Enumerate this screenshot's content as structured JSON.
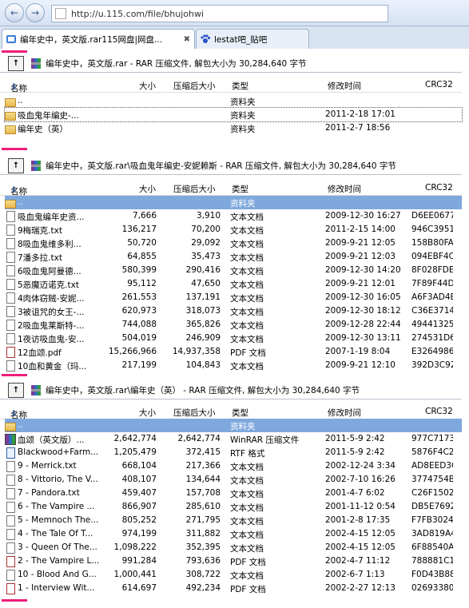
{
  "browser": {
    "url": "http://u.115.com/file/bhujohwi",
    "tabs": [
      {
        "label": "编年史中，英文版.rar115网盘|网盘..."
      },
      {
        "label": "lestat吧_贴吧"
      }
    ]
  },
  "columns": {
    "name": "名称",
    "size": "大小",
    "compressed": "压缩后大小",
    "type": "类型",
    "modified": "修改时间",
    "crc": "CRC32"
  },
  "panels": [
    {
      "path": "编年史中，英文版.rar - RAR 压缩文件, 解包大小为 30,284,640 字节",
      "rows": [
        {
          "icon": "folder",
          "name": "..",
          "size": "",
          "csize": "",
          "type": "资料夹",
          "time": "",
          "crc": ""
        },
        {
          "icon": "folder",
          "name": "吸血鬼年编史-...",
          "size": "",
          "csize": "",
          "type": "资料夹",
          "time": "2011-2-18 17:01",
          "crc": ""
        },
        {
          "icon": "folder",
          "name": "编年史（英）",
          "size": "",
          "csize": "",
          "type": "资料夹",
          "time": "2011-2-7 18:56",
          "crc": ""
        }
      ]
    },
    {
      "path": "编年史中，英文版.rar\\吸血鬼年编史-安妮赖斯 - RAR 压缩文件, 解包大小为 30,284,640 字节",
      "rows": [
        {
          "icon": "folder",
          "name": "..",
          "size": "",
          "csize": "",
          "type": "资料夹",
          "time": "",
          "crc": ""
        },
        {
          "icon": "txt",
          "name": "吸血鬼编年史资...",
          "size": "7,666",
          "csize": "3,910",
          "type": "文本文档",
          "time": "2009-12-30 16:27",
          "crc": "D6EE0677"
        },
        {
          "icon": "txt",
          "name": "9梅瑞克.txt",
          "size": "136,217",
          "csize": "70,200",
          "type": "文本文档",
          "time": "2011-2-15 14:00",
          "crc": "946C3951"
        },
        {
          "icon": "txt",
          "name": "8吸血鬼维多利...",
          "size": "50,720",
          "csize": "29,092",
          "type": "文本文档",
          "time": "2009-9-21 12:05",
          "crc": "158B80FA"
        },
        {
          "icon": "txt",
          "name": "7潘多拉.txt",
          "size": "64,855",
          "csize": "35,473",
          "type": "文本文档",
          "time": "2009-9-21 12:03",
          "crc": "094EBF4C"
        },
        {
          "icon": "txt",
          "name": "6吸血鬼阿曼德...",
          "size": "580,399",
          "csize": "290,416",
          "type": "文本文档",
          "time": "2009-12-30 14:20",
          "crc": "8F028FDE"
        },
        {
          "icon": "txt",
          "name": "5恶魔迈诺克.txt",
          "size": "95,112",
          "csize": "47,650",
          "type": "文本文档",
          "time": "2009-9-21 12:01",
          "crc": "7F89F44D"
        },
        {
          "icon": "txt",
          "name": "4肉体窃贼-安妮...",
          "size": "261,553",
          "csize": "137,191",
          "type": "文本文档",
          "time": "2009-12-30 16:05",
          "crc": "A6F3AD4E"
        },
        {
          "icon": "txt",
          "name": "3被诅咒的女王-...",
          "size": "620,973",
          "csize": "318,073",
          "type": "文本文档",
          "time": "2009-12-30 18:12",
          "crc": "C36E3714"
        },
        {
          "icon": "txt",
          "name": "2吸血鬼莱斯特-...",
          "size": "744,088",
          "csize": "365,826",
          "type": "文本文档",
          "time": "2009-12-28 22:44",
          "crc": "49441325"
        },
        {
          "icon": "txt",
          "name": "1夜访吸血鬼-安...",
          "size": "504,019",
          "csize": "246,909",
          "type": "文本文档",
          "time": "2009-12-30 13:11",
          "crc": "274531D6"
        },
        {
          "icon": "pdf",
          "name": "12血颂.pdf",
          "size": "15,266,966",
          "csize": "14,937,358",
          "type": "PDF 文档",
          "time": "2007-1-19 8:04",
          "crc": "E3264986"
        },
        {
          "icon": "txt",
          "name": "10血和黄金（玛...",
          "size": "217,199",
          "csize": "104,843",
          "type": "文本文档",
          "time": "2009-9-21 12:10",
          "crc": "392D3C92"
        }
      ]
    },
    {
      "path": "编年史中，英文版.rar\\编年史（英） - RAR 压缩文件, 解包大小为 30,284,640 字节",
      "rows": [
        {
          "icon": "folder",
          "name": "..",
          "size": "",
          "csize": "",
          "type": "资料夹",
          "time": "",
          "crc": ""
        },
        {
          "icon": "rar",
          "name": "血颂（英文版）...",
          "size": "2,642,774",
          "csize": "2,642,774",
          "type": "WinRAR 压缩文件",
          "time": "2011-5-9 2:42",
          "crc": "977C7173"
        },
        {
          "icon": "rtf",
          "name": "Blackwood+Farm...",
          "size": "1,205,479",
          "csize": "372,415",
          "type": "RTF 格式",
          "time": "2011-5-9 2:42",
          "crc": "5876F4C2"
        },
        {
          "icon": "txt",
          "name": "9 - Merrick.txt",
          "size": "668,104",
          "csize": "217,366",
          "type": "文本文档",
          "time": "2002-12-24 3:34",
          "crc": "AD8EED3C"
        },
        {
          "icon": "txt",
          "name": "8 - Vittorio, The V...",
          "size": "408,107",
          "csize": "134,644",
          "type": "文本文档",
          "time": "2002-7-10 16:26",
          "crc": "3774754B"
        },
        {
          "icon": "txt",
          "name": "7 - Pandora.txt",
          "size": "459,407",
          "csize": "157,708",
          "type": "文本文档",
          "time": "2001-4-7 6:02",
          "crc": "C26F1502"
        },
        {
          "icon": "txt",
          "name": "6 - The Vampire ...",
          "size": "866,907",
          "csize": "285,610",
          "type": "文本文档",
          "time": "2001-11-12 0:54",
          "crc": "DB5E7692"
        },
        {
          "icon": "txt",
          "name": "5 - Memnoch The...",
          "size": "805,252",
          "csize": "271,795",
          "type": "文本文档",
          "time": "2001-2-8 17:35",
          "crc": "F7FB3024"
        },
        {
          "icon": "txt",
          "name": "4 - The Tale Of T...",
          "size": "974,199",
          "csize": "311,882",
          "type": "文本文档",
          "time": "2002-4-15 12:05",
          "crc": "3AD819A4"
        },
        {
          "icon": "txt",
          "name": "3 - Queen Of The...",
          "size": "1,098,222",
          "csize": "352,395",
          "type": "文本文档",
          "time": "2002-4-15 12:05",
          "crc": "6F88540A"
        },
        {
          "icon": "pdf",
          "name": "2 - The Vampire L...",
          "size": "991,284",
          "csize": "793,636",
          "type": "PDF 文档",
          "time": "2002-4-7 11:12",
          "crc": "788881C1"
        },
        {
          "icon": "txt",
          "name": "10 - Blood And G...",
          "size": "1,000,441",
          "csize": "308,722",
          "type": "文本文档",
          "time": "2002-6-7 1:13",
          "crc": "F0D43B88"
        },
        {
          "icon": "pdf",
          "name": "1 - Interview Wit...",
          "size": "614,697",
          "csize": "492,234",
          "type": "PDF 文档",
          "time": "2002-2-27 12:13",
          "crc": "02693380"
        }
      ]
    }
  ]
}
